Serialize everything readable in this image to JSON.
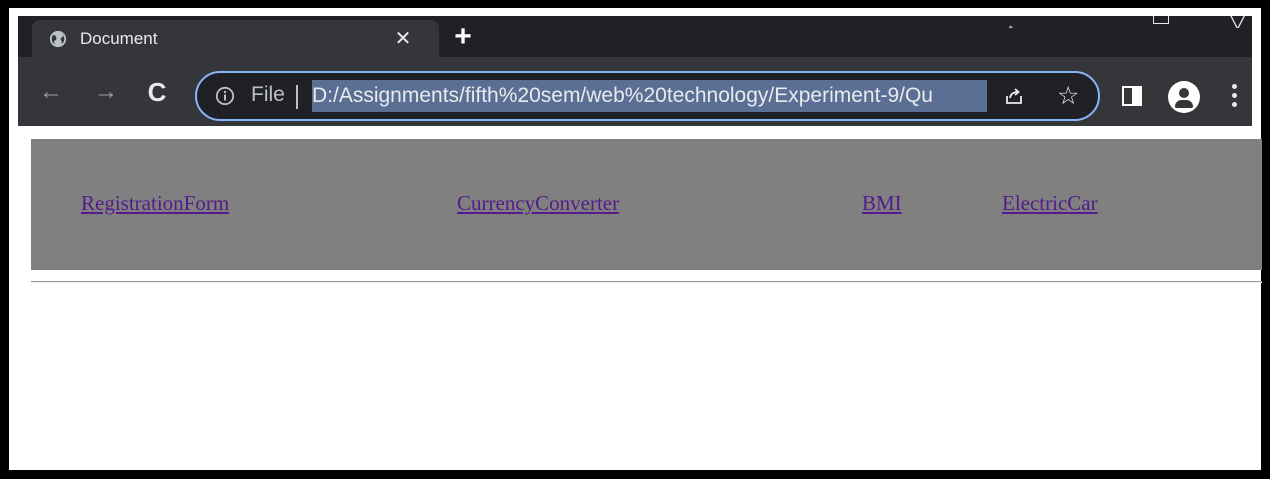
{
  "browser": {
    "tab": {
      "title": "Document",
      "favicon": "globe-icon",
      "close_glyph": "✕"
    },
    "new_tab_glyph": "+",
    "toolbar": {
      "back_glyph": "←",
      "forward_glyph": "→",
      "reload_glyph": "C",
      "star_glyph": "☆"
    },
    "omnibox": {
      "scheme_label": "File",
      "url": "D:/Assignments/fifth%20sem/web%20technology/Experiment-9/Qu"
    },
    "colors": {
      "tabstrip": "#202124",
      "toolbar": "#35363a",
      "omnibox_focus_ring": "#8ab4f8",
      "url_selection": "#5a6f93"
    }
  },
  "page": {
    "nav_links": [
      {
        "label": "RegistrationForm"
      },
      {
        "label": "CurrencyConverter"
      },
      {
        "label": "BMI"
      },
      {
        "label": "ElectricCar"
      }
    ],
    "colors": {
      "nav_background": "#808080",
      "visited_link": "#551a8b"
    }
  }
}
